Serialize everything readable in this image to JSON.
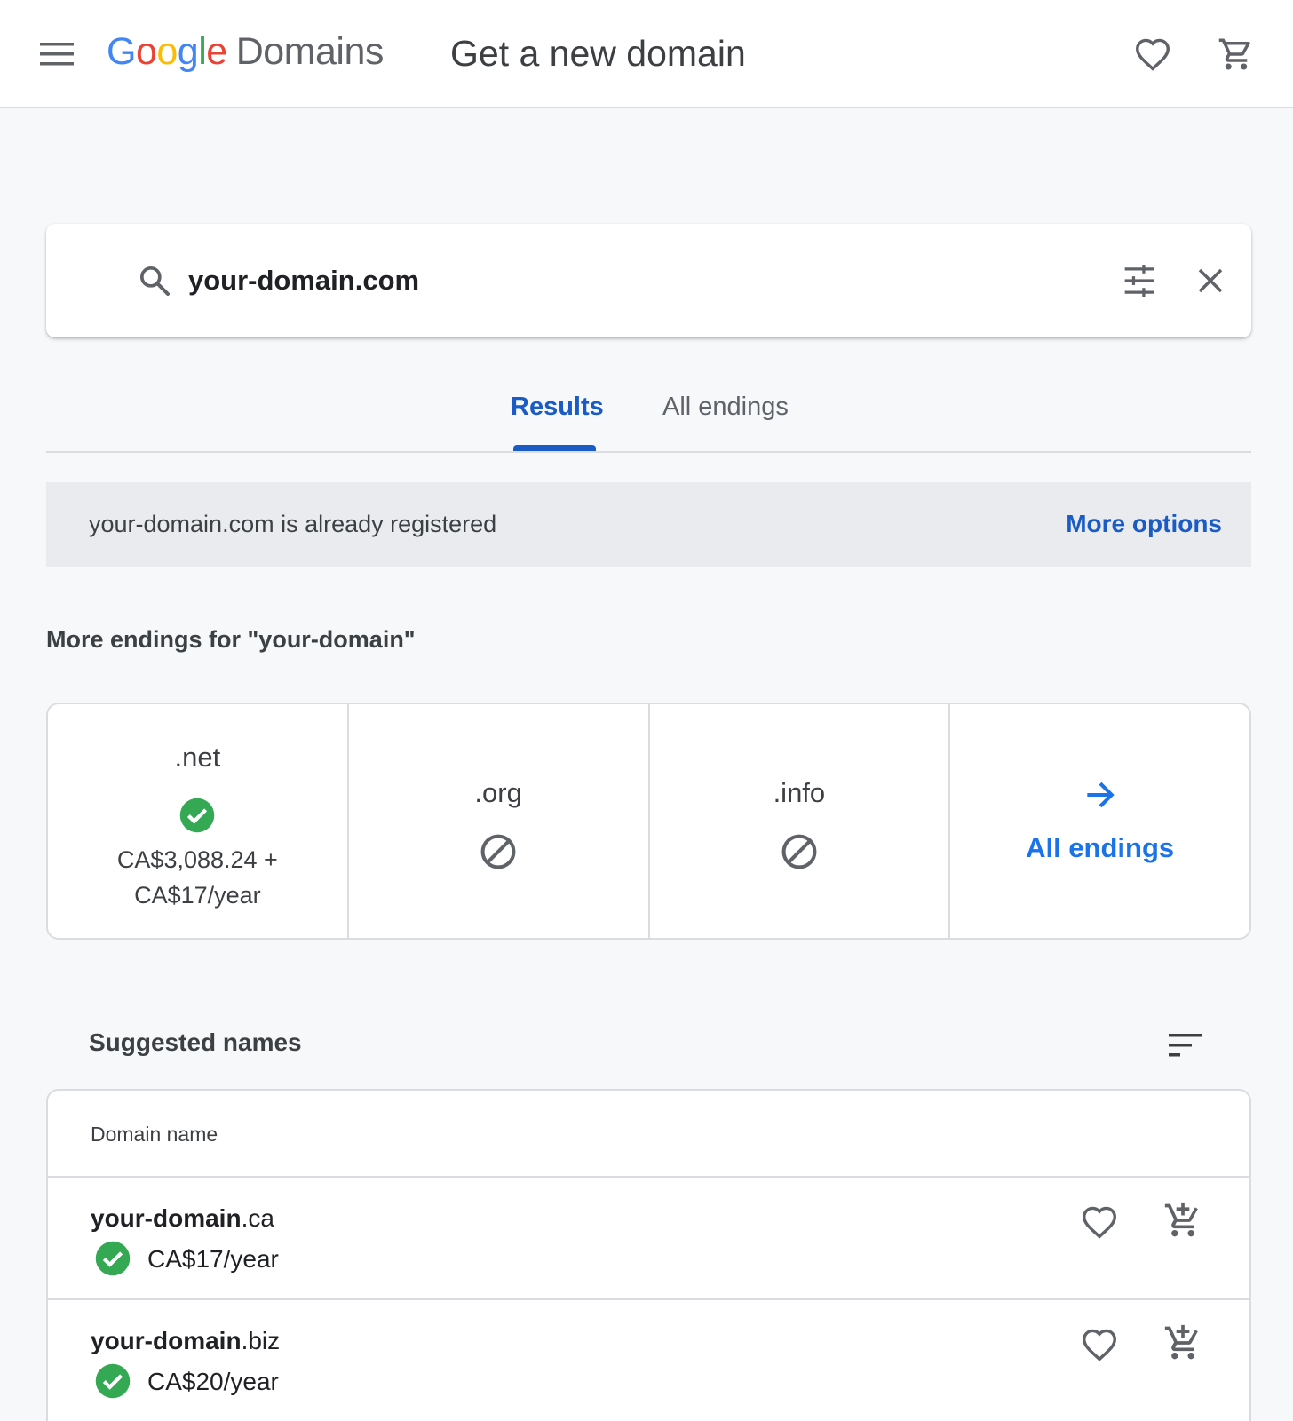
{
  "header": {
    "logo": {
      "g": "G",
      "o1": "o",
      "o2": "o",
      "g2": "g",
      "l": "l",
      "e": "e",
      "product": "Domains"
    },
    "title": "Get a new domain"
  },
  "search": {
    "value": "your-domain.com"
  },
  "tabs": [
    {
      "label": "Results",
      "active": true
    },
    {
      "label": "All endings",
      "active": false
    }
  ],
  "notice": {
    "text": "your-domain.com is already registered",
    "link": "More options"
  },
  "more_endings": {
    "title": "More endings for \"your-domain\"",
    "items": [
      {
        "ending": ".net",
        "status": "available",
        "price_line1": "CA$3,088.24 +",
        "price_line2": "CA$17/year"
      },
      {
        "ending": ".org",
        "status": "unavailable"
      },
      {
        "ending": ".info",
        "status": "unavailable"
      }
    ],
    "all_label": "All endings"
  },
  "suggested": {
    "title": "Suggested names",
    "column": "Domain name",
    "rows": [
      {
        "base": "your-domain",
        "tld": ".ca",
        "price": "CA$17/year",
        "status": "available"
      },
      {
        "base": "your-domain",
        "tld": ".biz",
        "price": "CA$20/year",
        "status": "available"
      }
    ]
  },
  "colors": {
    "accent": "#1a5bc4",
    "link": "#1a73e8",
    "available": "#34a853",
    "text": "#3c4043"
  }
}
